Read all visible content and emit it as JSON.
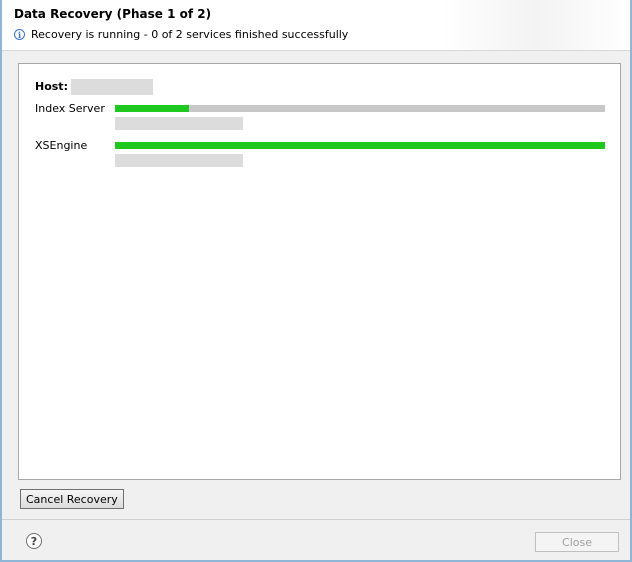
{
  "dialog": {
    "title": "Data Recovery (Phase 1 of 2)",
    "status_icon": "info-icon",
    "status_text": "Recovery is running - 0 of 2 services finished successfully"
  },
  "content": {
    "host_label": "Host:",
    "services": [
      {
        "name": "Index Server",
        "progress": 0.15
      },
      {
        "name": "XSEngine",
        "progress": 1.0
      }
    ]
  },
  "buttons": {
    "cancel_label": "Cancel Recovery",
    "close_label": "Close",
    "help_icon": "help-icon",
    "help_glyph": "?"
  },
  "colors": {
    "progress_fill": "#1ec81e",
    "progress_track": "#c8c8c8"
  }
}
